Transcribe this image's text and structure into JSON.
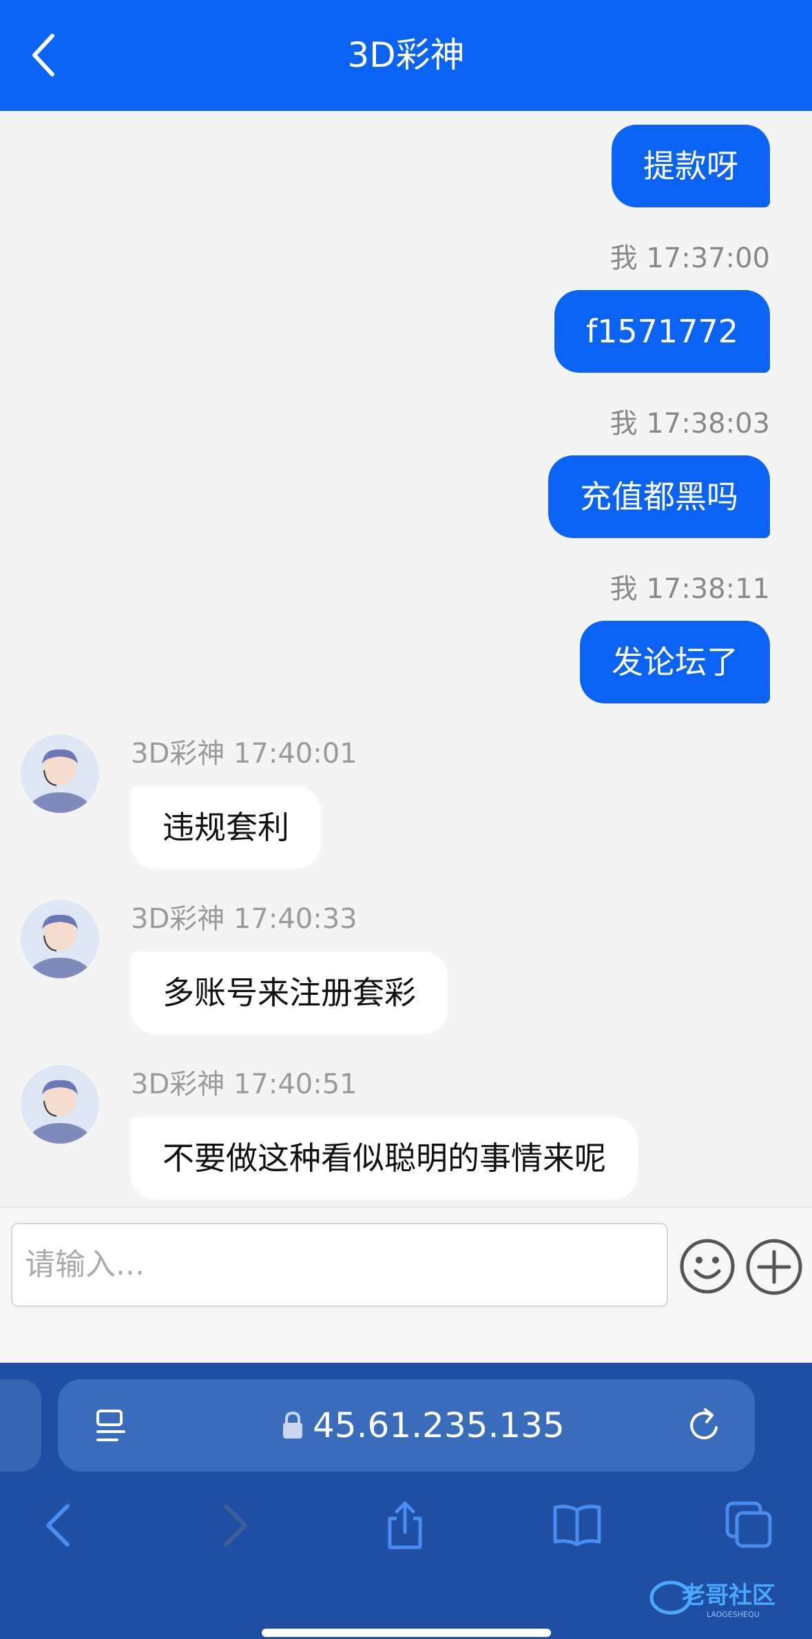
{
  "header": {
    "title": "3D彩神"
  },
  "messages_me": [
    {
      "text": "提款呀"
    },
    {
      "meta": "我 17:37:00",
      "text": "f1571772"
    },
    {
      "meta": "我 17:38:03",
      "text": "充值都黑吗"
    },
    {
      "meta": "我 17:38:11",
      "text": "发论坛了"
    }
  ],
  "messages_other": [
    {
      "meta": "3D彩神 17:40:01",
      "text": "违规套利"
    },
    {
      "meta": "3D彩神 17:40:33",
      "text": "多账号来注册套彩"
    },
    {
      "meta": "3D彩神 17:40:51",
      "text": "不要做这种看似聪明的事情来呢"
    }
  ],
  "input": {
    "placeholder": "请输入..."
  },
  "browser": {
    "url": "45.61.235.135"
  },
  "watermark": {
    "text": "老哥社区",
    "sub": "LAOGESHEQU"
  },
  "colors": {
    "accent": "#0a63f4",
    "browser_bar": "#1e4fa3"
  }
}
